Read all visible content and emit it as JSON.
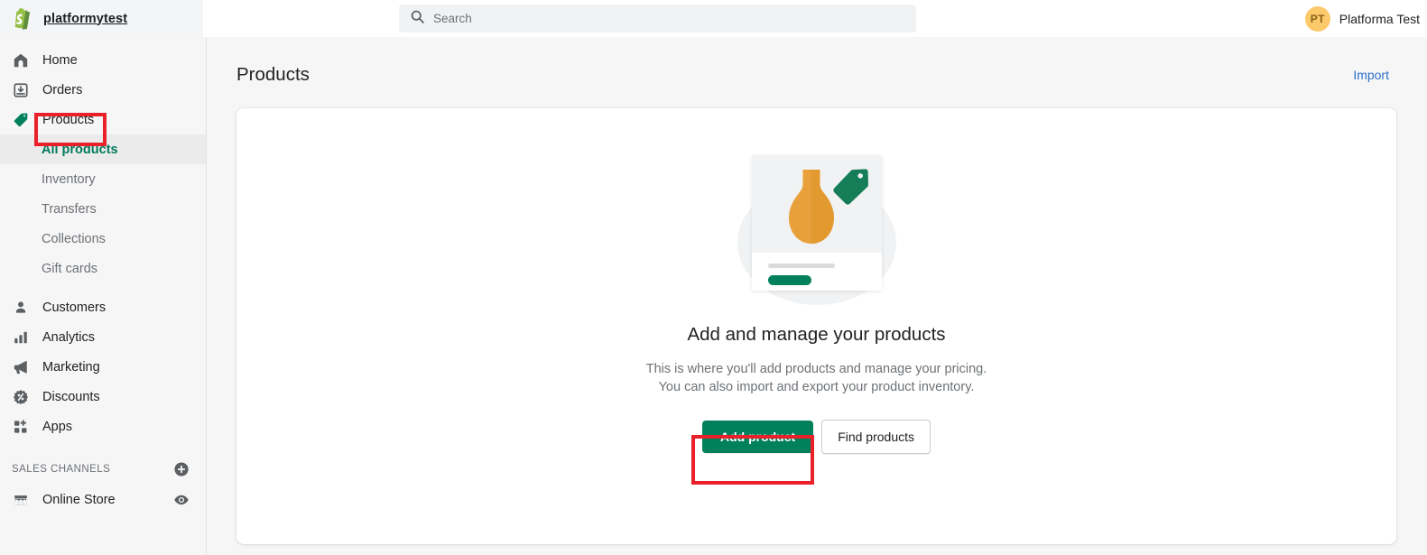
{
  "topbar": {
    "store_name": "platformytest",
    "logo_icon": "shopify-bag-icon",
    "search": {
      "placeholder": "Search",
      "value": "",
      "icon": "search-icon"
    },
    "user": {
      "initials": "PT",
      "name": "Platforma Test"
    }
  },
  "sidebar": {
    "items": [
      {
        "label": "Home",
        "icon": "home-icon",
        "active": false
      },
      {
        "label": "Orders",
        "icon": "orders-inbox-icon",
        "active": false
      },
      {
        "label": "Products",
        "icon": "products-tag-icon",
        "active": true
      }
    ],
    "subitems": [
      {
        "label": "All products",
        "selected": true
      },
      {
        "label": "Inventory",
        "selected": false
      },
      {
        "label": "Transfers",
        "selected": false
      },
      {
        "label": "Collections",
        "selected": false
      },
      {
        "label": "Gift cards",
        "selected": false
      }
    ],
    "items2": [
      {
        "label": "Customers",
        "icon": "customer-person-icon"
      },
      {
        "label": "Analytics",
        "icon": "analytics-bars-icon"
      },
      {
        "label": "Marketing",
        "icon": "marketing-megaphone-icon"
      },
      {
        "label": "Discounts",
        "icon": "discounts-percent-badge-icon"
      },
      {
        "label": "Apps",
        "icon": "apps-grid-plus-icon"
      }
    ],
    "sales_channels": {
      "title": "SALES CHANNELS",
      "add_icon": "plus-circle-icon",
      "channels": [
        {
          "label": "Online Store",
          "icon": "storefront-icon",
          "action_icon": "eye-icon"
        }
      ]
    }
  },
  "main": {
    "page_title": "Products",
    "import_label": "Import",
    "empty_state": {
      "illustration_icon": "product-card-vase-tag-illustration",
      "title": "Add and manage your products",
      "description": "This is where you'll add products and manage your pricing. You can also import and export your product inventory.",
      "primary_button": "Add product",
      "secondary_button": "Find products"
    }
  },
  "annotations": {
    "highlight_color": "#e8212b",
    "boxes": [
      {
        "target": "sidebar-item-products"
      },
      {
        "target": "add-product-button"
      }
    ]
  },
  "colors": {
    "brand_green": "#00805b",
    "accent_link": "#2c6ecb",
    "avatar_bg": "#fcc96b",
    "page_bg": "#f6f6f7"
  }
}
